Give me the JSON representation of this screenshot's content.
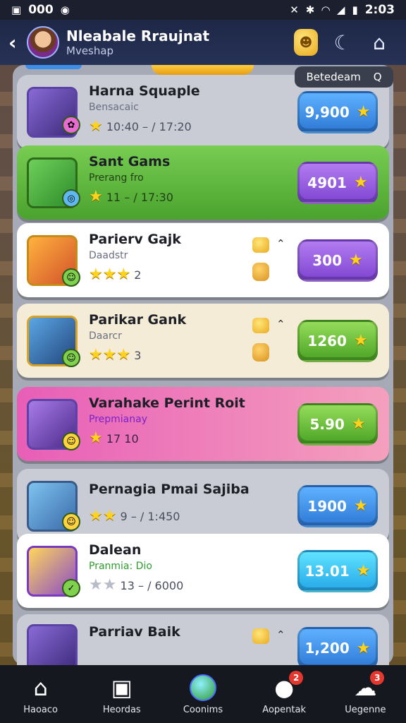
{
  "status": {
    "time_left": "000",
    "time_right": "2:03"
  },
  "header": {
    "title": "Nleabale Rraujnat",
    "subtitle": "Mveshap"
  },
  "sort": {
    "label": "Betedeam",
    "value": "Q"
  },
  "rows": [
    {
      "name": "Harna Squaple",
      "sub": "Bensacaic",
      "meta": "10:40 – / 17:20",
      "price": "9,900",
      "style": "grey",
      "button": "blue"
    },
    {
      "name": "Sant Gams",
      "sub": "Prerang fro",
      "meta": "11 – / 17:30",
      "price": "4901",
      "style": "green",
      "button": "purple"
    },
    {
      "name": "Parierv Gajk",
      "sub": "Daadstr",
      "meta": "2",
      "price": "300",
      "style": "white",
      "button": "purple"
    },
    {
      "name": "Parikar Gank",
      "sub": "Daarcr",
      "meta": "3",
      "price": "1260",
      "style": "cream",
      "button": "green"
    },
    {
      "name": "Varahake Perint Roit",
      "sub": "Prepmianay",
      "meta": "17 10",
      "price": "5.90",
      "style": "pink",
      "button": "green"
    },
    {
      "name": "Pernagia Pmai Sajiba",
      "sub": "",
      "meta": "9 – / 1:450",
      "price": "1900",
      "style": "grey",
      "button": "blue"
    },
    {
      "name": "Dalean",
      "sub": "Pranmia: Dio",
      "meta": "13 – / 6000",
      "price": "13.01",
      "style": "white",
      "button": "cyan"
    },
    {
      "name": "Parriav Baik",
      "sub": "",
      "meta": "",
      "price": "1,200",
      "style": "grey",
      "button": "blue"
    }
  ],
  "nav": [
    {
      "label": "Haoaco",
      "icon": "home-icon"
    },
    {
      "label": "Heordas",
      "icon": "calendar-icon"
    },
    {
      "label": "Coonims",
      "icon": "globe-icon"
    },
    {
      "label": "Aopentak",
      "icon": "rock-icon",
      "badge": "2"
    },
    {
      "label": "Uegenne",
      "icon": "pet-icon",
      "badge": "3"
    }
  ]
}
